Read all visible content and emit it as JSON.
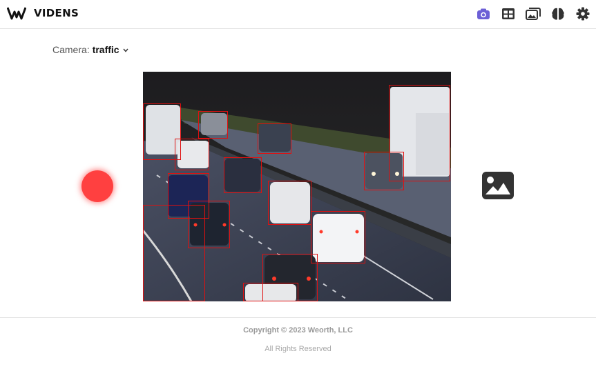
{
  "app": {
    "name": "VIDENS",
    "logo_icon": "videns-logo"
  },
  "nav": {
    "items": [
      {
        "icon": "camera-icon",
        "active": true,
        "color": "#6c5fd6"
      },
      {
        "icon": "table-icon",
        "active": false,
        "color": "#333333"
      },
      {
        "icon": "photo-library-icon",
        "active": false,
        "color": "#333333"
      },
      {
        "icon": "brain-icon",
        "active": false,
        "color": "#333333"
      },
      {
        "icon": "gear-icon",
        "active": false,
        "color": "#333333"
      }
    ]
  },
  "camera": {
    "label": "Camera:",
    "selected": "traffic"
  },
  "controls": {
    "record_color": "#ff4040"
  },
  "detections": {
    "box_color": "#e01010",
    "count": 16
  },
  "footer": {
    "copyright": "Copyright © 2023 Weorth, LLC",
    "rights": "All Rights Reserved"
  }
}
